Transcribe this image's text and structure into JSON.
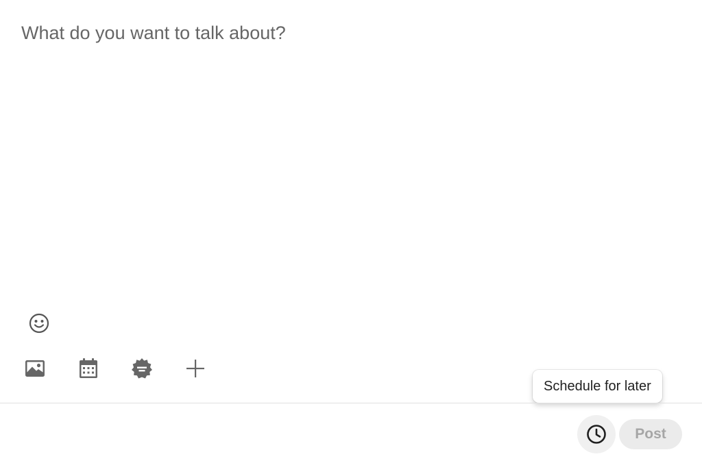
{
  "editor": {
    "placeholder": "What do you want to talk about?",
    "value": ""
  },
  "toolbar": {
    "emoji_icon": "smiley-icon",
    "items": [
      {
        "icon": "image-icon"
      },
      {
        "icon": "calendar-icon"
      },
      {
        "icon": "celebrate-badge-icon"
      },
      {
        "icon": "plus-icon"
      }
    ]
  },
  "footer": {
    "tooltip_text": "Schedule for later",
    "schedule_icon": "clock-icon",
    "post_label": "Post"
  },
  "colors": {
    "icon": "#666666",
    "placeholder": "#666666",
    "post_disabled_bg": "#ebebeb",
    "post_disabled_text": "#a6a6a6",
    "schedule_bg": "#f0f0f0",
    "divider": "#e0e0e0"
  }
}
